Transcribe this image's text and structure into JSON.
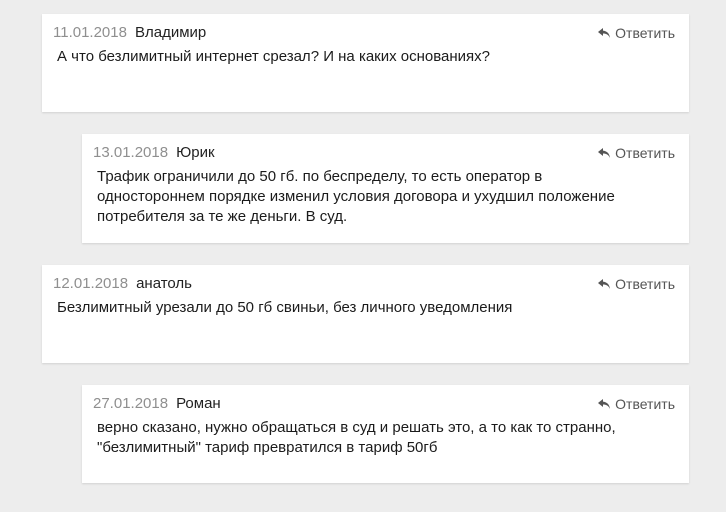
{
  "comments": [
    {
      "date": "11.01.2018",
      "author": "Владимир",
      "reply_label": "Ответить",
      "text": "А что безлимитный интернет срезал? И на каких основаниях?"
    },
    {
      "date": "13.01.2018",
      "author": "Юрик",
      "reply_label": "Ответить",
      "text": "Трафик ограничили до 50 гб. по беспределу, то есть оператор в одностороннем порядке изменил условия договора и ухудшил положение потребителя за те же деньги. В суд."
    },
    {
      "date": "12.01.2018",
      "author": "анатоль",
      "reply_label": "Ответить",
      "text": "Безлимитный урезали до 50 гб свиньи, без личного уведомления"
    },
    {
      "date": "27.01.2018",
      "author": "Роман",
      "reply_label": "Ответить",
      "text": "верно сказано, нужно обращаться в суд и решать это, а то как то странно, \"безлимитный\" тариф превратился в тариф 50гб"
    }
  ],
  "icons": {
    "reply": "reply-arrow-icon"
  }
}
